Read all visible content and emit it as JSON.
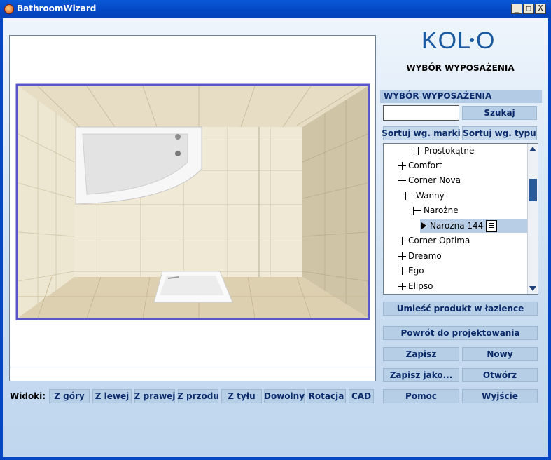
{
  "window": {
    "title": "BathroomWizard",
    "buttons": {
      "minimize": "_",
      "maximize": "□",
      "close": "X"
    }
  },
  "brand": {
    "logo_text": "KOL·O",
    "logo_color": "#1c5aa0"
  },
  "panel": {
    "title": "WYBÓR WYPOSAŻENIA",
    "section_header": "WYBÓR WYPOSAŻENIA"
  },
  "search": {
    "value": "",
    "button": "Szukaj"
  },
  "sort": {
    "by_brand": "Sortuj wg. marki",
    "by_type": "Sortuj wg. typu"
  },
  "tree": [
    {
      "label": "Prostokątne",
      "expander": "plus"
    },
    {
      "label": "Comfort",
      "expander": "plus"
    },
    {
      "label": "Corner Nova",
      "expander": "minus"
    },
    {
      "label": "Wanny",
      "expander": "minus"
    },
    {
      "label": "Narożne",
      "expander": "minus"
    },
    {
      "label": "Narożna 144",
      "expander": "leaf",
      "selected": true
    },
    {
      "label": "Corner Optima",
      "expander": "plus"
    },
    {
      "label": "Dreamo",
      "expander": "plus"
    },
    {
      "label": "Ego",
      "expander": "plus"
    },
    {
      "label": "Elipso",
      "expander": "plus"
    }
  ],
  "actions": {
    "place_product": "Umieść produkt w łazience",
    "back_to_design": "Powrót do projektowania",
    "save": "Zapisz",
    "new": "Nowy",
    "save_as": "Zapisz jako...",
    "open": "Otwórz",
    "help": "Pomoc",
    "exit": "Wyjście"
  },
  "views": {
    "label": "Widoki:",
    "items": [
      "Z góry",
      "Z lewej",
      "Z prawej",
      "Z przodu",
      "Z tyłu",
      "Dowolny",
      "Rotacja",
      "CAD"
    ]
  },
  "colors": {
    "titlebar": "#0446c4",
    "button_bg": "#b7cfe6",
    "button_text": "#0a2a6a",
    "tile_light": "#ede6d0",
    "tile_dark": "#ddd2b6"
  }
}
